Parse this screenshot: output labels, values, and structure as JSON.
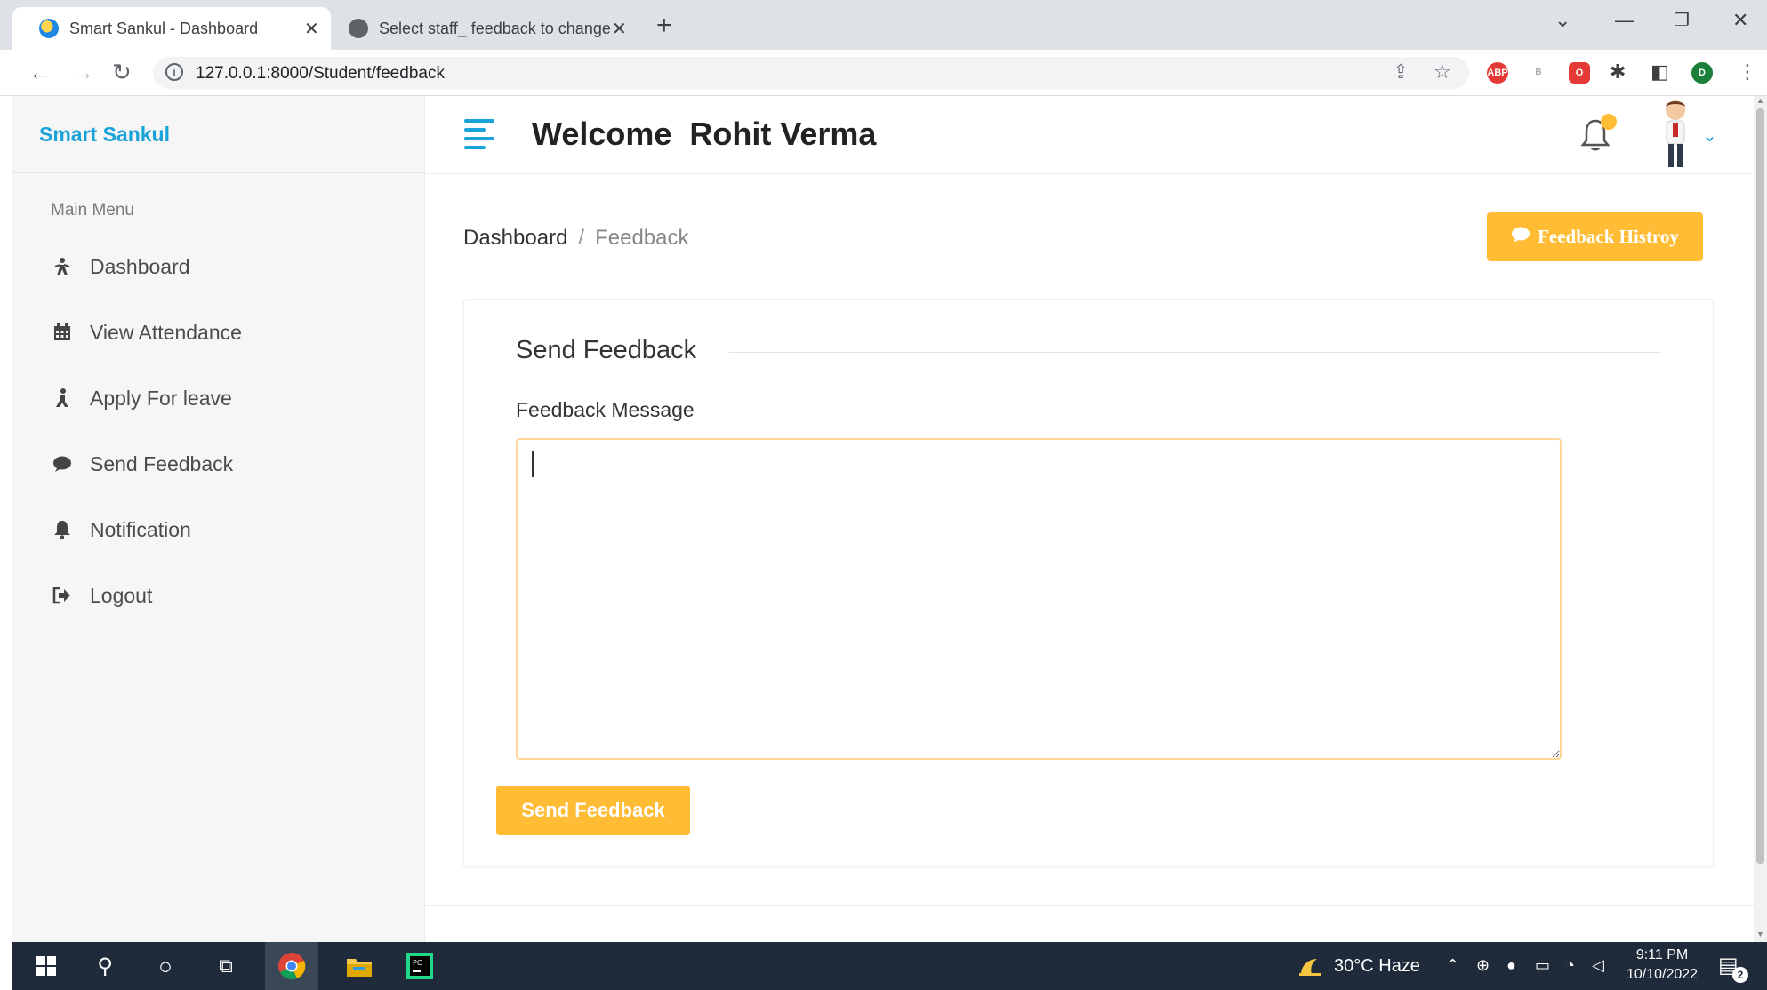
{
  "browser": {
    "tabs": [
      {
        "title": "Smart Sankul - Dashboard",
        "active": true
      },
      {
        "title": "Select staff_ feedback to change",
        "active": false
      }
    ],
    "url": "127.0.0.1:8000/Student/feedback",
    "profile_initial": "D",
    "abp_label": "ABP"
  },
  "sidebar": {
    "brand": "Smart Sankul",
    "menu_title": "Main Menu",
    "items": [
      {
        "label": "Dashboard",
        "icon": "dashboard-icon"
      },
      {
        "label": "View Attendance",
        "icon": "calendar-icon"
      },
      {
        "label": "Apply For leave",
        "icon": "leave-icon"
      },
      {
        "label": "Send Feedback",
        "icon": "comment-icon"
      },
      {
        "label": "Notification",
        "icon": "bell-icon"
      },
      {
        "label": "Logout",
        "icon": "logout-icon"
      }
    ]
  },
  "header": {
    "welcome": "Welcome  Rohit Verma"
  },
  "breadcrumb": {
    "home": "Dashboard",
    "separator": "/",
    "current": "Feedback"
  },
  "actions": {
    "history_label": "Feedback Histroy"
  },
  "form": {
    "title": "Send Feedback",
    "field_label": "Feedback Message",
    "message_value": "",
    "submit_label": "Send Feedback"
  },
  "taskbar": {
    "weather": "30°C  Haze",
    "time": "9:11 PM",
    "date": "10/10/2022",
    "notification_count": "2"
  },
  "colors": {
    "accent": "#1aa3d8",
    "button": "#ffbc34",
    "input_border": "#ffd699"
  }
}
